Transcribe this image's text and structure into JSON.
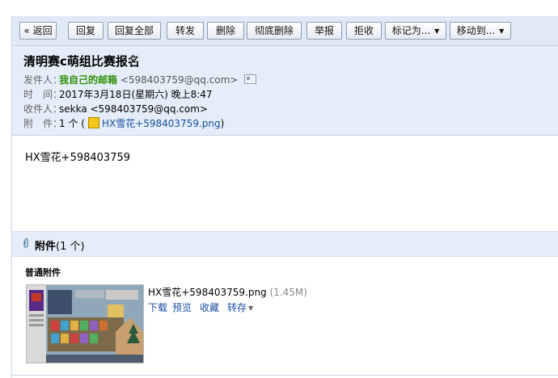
{
  "toolbar": {
    "back": "« 返回",
    "reply": "回复",
    "reply_all": "回复全部",
    "forward": "转发",
    "delete": "删除",
    "delete_forever": "彻底删除",
    "report": "举报",
    "reject": "拒收",
    "mark_as": "标记为...",
    "move_to": "移动到..."
  },
  "mail": {
    "subject": "清明赛c萌组比赛报名",
    "sender_label": "发件人：",
    "sender_name": "我自己的邮箱",
    "sender_addr": "<598403759@qq.com>",
    "time_label": "时　间：",
    "time_value": "2017年3月18日(星期六) 晚上8:47",
    "recipient_label": "收件人：",
    "recipient_value": "sekka <598403759@qq.com>",
    "attachment_label": "附　件：",
    "attachment_count": "1 个 (",
    "attachment_file": "HX雪花+598403759.png",
    "attachment_close": ")",
    "body": "HX雪花+598403759"
  },
  "attachments": {
    "title": "附件",
    "count": "(1 个)",
    "section": "普通附件",
    "file_name": "HX雪花+598403759.png",
    "file_size": "(1.45M)",
    "actions": {
      "download": "下载",
      "preview": "预览",
      "collect": "收藏",
      "save_to": "转存"
    }
  },
  "colors": {
    "toolbar_bg": "#dfeaf6",
    "header_bg": "#e5eef8",
    "sender_green": "#2f8f0a",
    "link_blue": "#1a4ea3"
  },
  "icons": [
    "star-icon",
    "contact-card-icon",
    "image-file-icon",
    "paperclip-icon",
    "caret-down-icon"
  ]
}
